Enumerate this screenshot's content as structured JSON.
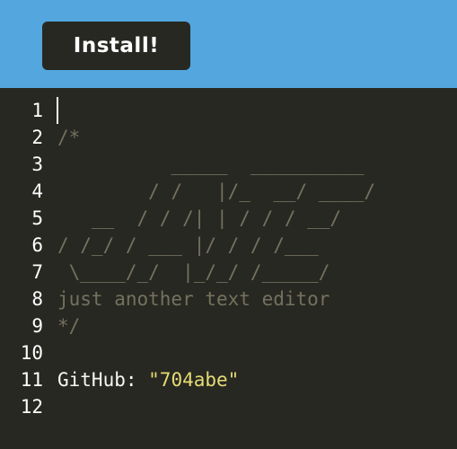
{
  "header": {
    "install_label": "Install!"
  },
  "editor": {
    "lines": [
      {
        "num": "1",
        "text": ""
      },
      {
        "num": "2",
        "text": "/*"
      },
      {
        "num": "3",
        "text": "          _____  __________"
      },
      {
        "num": "4",
        "text": "        / /   |/_  __/ ____/"
      },
      {
        "num": "5",
        "text": "   __  / / /| | / / / __/"
      },
      {
        "num": "6",
        "text": "/ /_/ / ___ |/ / / /___"
      },
      {
        "num": "7",
        "text": " \\____/_/  |_/_/ /_____/"
      },
      {
        "num": "8",
        "text": "just another text editor"
      },
      {
        "num": "9",
        "text": "*/"
      },
      {
        "num": "10",
        "text": ""
      },
      {
        "num": "11",
        "key": "GitHub: ",
        "value": "\"704abe\""
      },
      {
        "num": "12",
        "text": ""
      }
    ]
  },
  "colors": {
    "header_bg": "#53a6de",
    "editor_bg": "#272822",
    "comment": "#75715e",
    "plain": "#f8f8f2",
    "string": "#e6db74"
  }
}
